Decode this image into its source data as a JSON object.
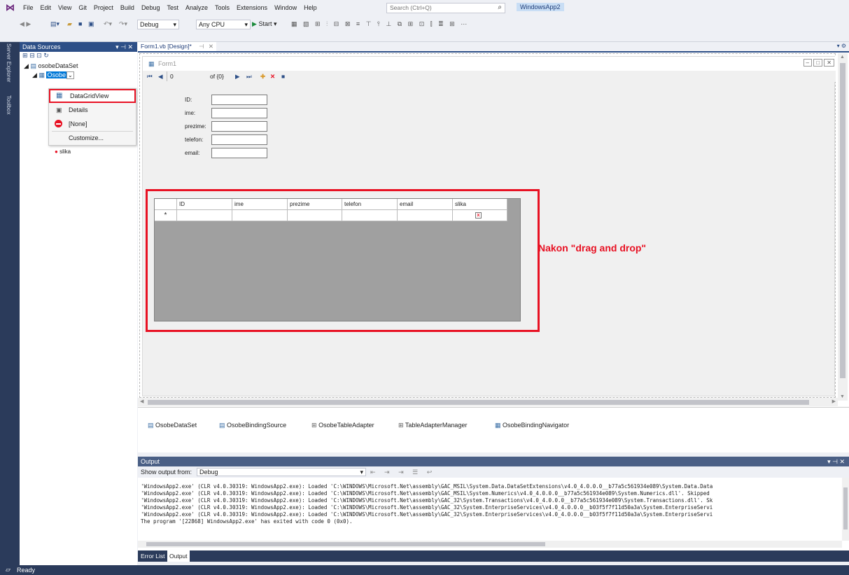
{
  "menu": {
    "items": [
      "File",
      "Edit",
      "View",
      "Git",
      "Project",
      "Build",
      "Debug",
      "Test",
      "Analyze",
      "Tools",
      "Extensions",
      "Window",
      "Help"
    ],
    "search_placeholder": "Search (Ctrl+Q)",
    "solution_name": "WindowsApp2"
  },
  "toolbar": {
    "config": "Debug",
    "platform": "Any CPU",
    "start_label": "Start"
  },
  "side_tabs": {
    "server_explorer": "Server Explorer",
    "toolbox": "Toolbox"
  },
  "data_sources": {
    "title": "Data Sources",
    "dataset": "osobeDataSet",
    "table": "Osobe",
    "hidden_item": "slika",
    "menu": [
      "DataGridView",
      "Details",
      "[None]",
      "Customize..."
    ]
  },
  "document": {
    "tab": "Form1.vb [Design]*",
    "form_title": "Form1",
    "nav": {
      "position": "0",
      "of_count": "of {0}"
    },
    "fields": [
      "ID:",
      "ime:",
      "prezime:",
      "telefon:",
      "email:"
    ],
    "grid_columns": [
      "ID",
      "ime",
      "prezime",
      "telefon",
      "email",
      "slika"
    ],
    "grid_row_marker": "*",
    "annotation": "Nakon \"drag and drop\""
  },
  "tray": [
    "OsobeDataSet",
    "OsobeBindingSource",
    "OsobeTableAdapter",
    "TableAdapterManager",
    "OsobeBindingNavigator"
  ],
  "output": {
    "title": "Output",
    "show_label": "Show output from:",
    "source": "Debug",
    "lines": [
      "'WindowsApp2.exe' (CLR v4.0.30319: WindowsApp2.exe): Loaded 'C:\\WINDOWS\\Microsoft.Net\\assembly\\GAC_MSIL\\System.Data.DataSetExtensions\\v4.0_4.0.0.0__b77a5c561934e089\\System.Data.Data",
      "'WindowsApp2.exe' (CLR v4.0.30319: WindowsApp2.exe): Loaded 'C:\\WINDOWS\\Microsoft.Net\\assembly\\GAC_MSIL\\System.Numerics\\v4.0_4.0.0.0__b77a5c561934e089\\System.Numerics.dll'. Skipped",
      "'WindowsApp2.exe' (CLR v4.0.30319: WindowsApp2.exe): Loaded 'C:\\WINDOWS\\Microsoft.Net\\assembly\\GAC_32\\System.Transactions\\v4.0_4.0.0.0__b77a5c561934e089\\System.Transactions.dll'. Sk",
      "'WindowsApp2.exe' (CLR v4.0.30319: WindowsApp2.exe): Loaded 'C:\\WINDOWS\\Microsoft.Net\\assembly\\GAC_32\\System.EnterpriseServices\\v4.0_4.0.0.0__b03f5f7f11d50a3a\\System.EnterpriseServi",
      "'WindowsApp2.exe' (CLR v4.0.30319: WindowsApp2.exe): Loaded 'C:\\WINDOWS\\Microsoft.Net\\assembly\\GAC_32\\System.EnterpriseServices\\v4.0_4.0.0.0__b03f5f7f11d50a3a\\System.EnterpriseServi",
      "The program '[22868] WindowsApp2.exe' has exited with code 0 (0x0)."
    ],
    "tabs": [
      "Error List",
      "Output"
    ]
  },
  "status": {
    "text": "Ready"
  },
  "colors": {
    "accent_red": "#e81123",
    "title_blue": "#2d4f87",
    "grid_gray": "#a0a0a0"
  }
}
